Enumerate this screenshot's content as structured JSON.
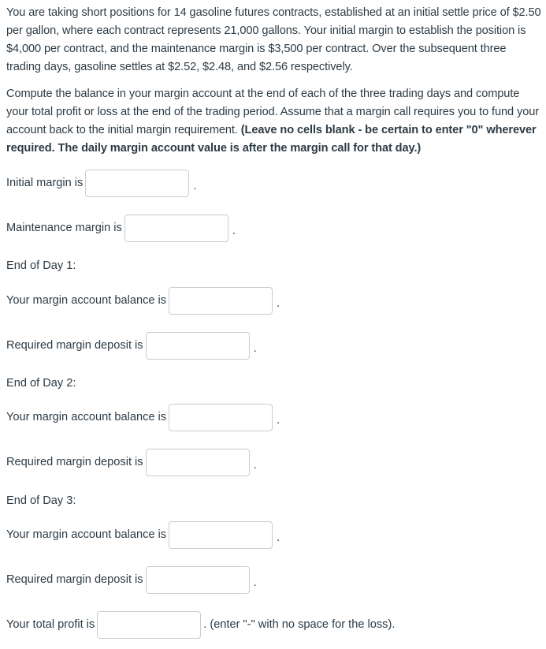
{
  "question": {
    "paragraph1": "You are taking short positions for 14 gasoline futures contracts, established at an initial settle price of $2.50 per gallon, where each contract represents 21,000 gallons. Your initial margin to establish the position is $4,000 per contract, and the maintenance margin is $3,500 per contract. Over the subsequent three trading days, gasoline settles at $2.52, $2.48, and $2.56 respectively.",
    "paragraph2_normal": "Compute the balance in your margin account at the end of each of the three trading days and compute your total profit or loss at the end of the trading period. Assume that a margin call requires you to fund your account back to the initial margin requirement. ",
    "paragraph2_bold": "(Leave no cells blank - be certain to enter \"0\" wherever required. The daily margin account value is after the margin call for that day.)"
  },
  "fields": {
    "initial_margin": {
      "label": "Initial margin is",
      "value": "",
      "suffix": "."
    },
    "maintenance_margin": {
      "label": "Maintenance margin is",
      "value": "",
      "suffix": "."
    },
    "total_profit": {
      "label": "Your total profit is",
      "value": "",
      "suffix": ". (enter \"-\" with no space for the loss)."
    }
  },
  "days": [
    {
      "heading": "End of Day 1:",
      "balance_label": "Your margin account balance is",
      "balance_value": "",
      "deposit_label": "Required margin deposit is",
      "deposit_value": ""
    },
    {
      "heading": "End of Day 2:",
      "balance_label": "Your margin account balance is",
      "balance_value": "",
      "deposit_label": "Required margin deposit is",
      "deposit_value": ""
    },
    {
      "heading": "End of Day 3:",
      "balance_label": "Your margin account balance is",
      "balance_value": "",
      "deposit_label": "Required margin deposit is",
      "deposit_value": ""
    }
  ],
  "punctuation": "."
}
